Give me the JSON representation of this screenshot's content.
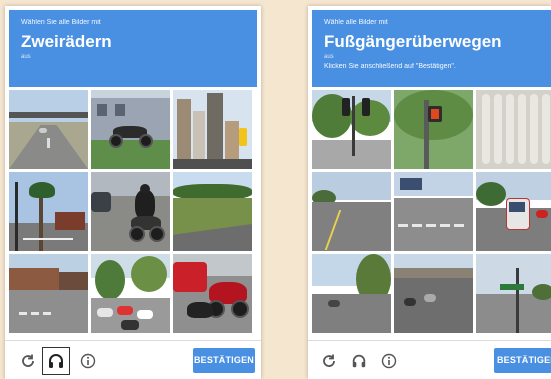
{
  "left": {
    "header": {
      "instruction": "Wählen Sie alle Bilder mit",
      "target": "Zweirädern",
      "suffix": "aus"
    },
    "tiles": [
      {
        "label": "highway-road"
      },
      {
        "label": "motorcycle-parked"
      },
      {
        "label": "tall-buildings"
      },
      {
        "label": "palm-tree-street"
      },
      {
        "label": "motorcycle-rider"
      },
      {
        "label": "field-road"
      },
      {
        "label": "residential-street"
      },
      {
        "label": "parking-lot"
      },
      {
        "label": "red-motorcycles"
      }
    ],
    "footer": {
      "reload_icon": "reload-icon",
      "audio_icon": "headphones-icon",
      "info_icon": "info-icon",
      "verify_label": "BESTÄTIGEN"
    }
  },
  "right": {
    "header": {
      "instruction": "Wähle alle Bilder mit",
      "target": "Fußgängerüberwegen",
      "suffix": "aus",
      "note": "Klicken Sie anschließend auf \"Bestätigen\"."
    },
    "tiles": [
      {
        "label": "traffic-light-trees"
      },
      {
        "label": "pedestrian-signal"
      },
      {
        "label": "radiator"
      },
      {
        "label": "wide-road"
      },
      {
        "label": "crosswalk-road"
      },
      {
        "label": "bus-road"
      },
      {
        "label": "tree-road"
      },
      {
        "label": "underpass-road"
      },
      {
        "label": "signpost-road"
      }
    ],
    "footer": {
      "reload_icon": "reload-icon",
      "audio_icon": "headphones-icon",
      "info_icon": "info-icon",
      "verify_label": "BESTÄTIGEN"
    }
  },
  "colors": {
    "accent": "#4a90e2",
    "background": "#f5e6cf"
  }
}
